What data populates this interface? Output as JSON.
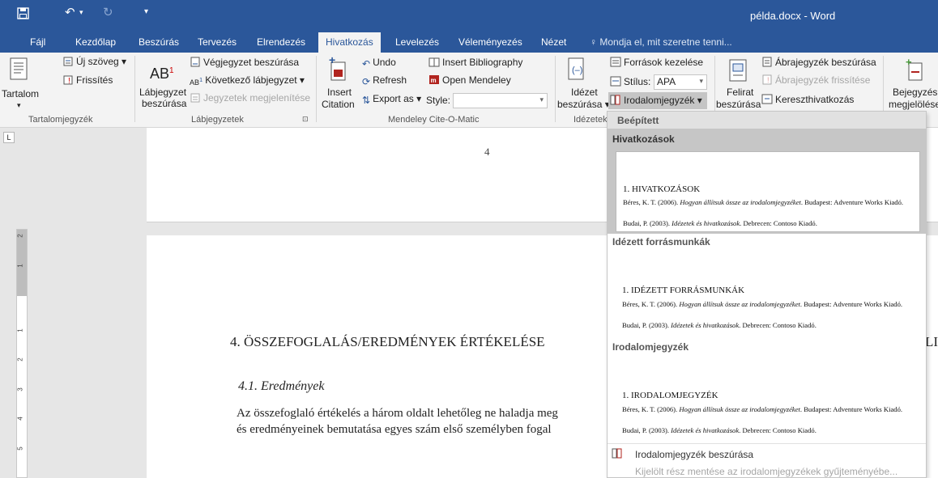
{
  "window": {
    "title": "példa.docx - Word"
  },
  "tabs": [
    "Fájl",
    "Kezdőlap",
    "Beszúrás",
    "Tervezés",
    "Elrendezés",
    "Hivatkozás",
    "Levelezés",
    "Véleményezés",
    "Nézet"
  ],
  "tell_me": "Mondja el, mit szeretne tenni...",
  "ribbon": {
    "toc": {
      "label1": "Tartalom",
      "add_text": "Új szöveg",
      "update": "Frissítés",
      "group": "Tartalomjegyzék"
    },
    "footnotes": {
      "insert_line1": "Lábjegyzet",
      "insert_line2": "beszúrása",
      "endnote": "Végjegyzet beszúrása",
      "next": "Következő lábjegyzet",
      "show": "Jegyzetek megjelenítése",
      "group": "Lábjegyzetek"
    },
    "mendeley": {
      "insert_line1": "Insert",
      "insert_line2": "Citation",
      "undo": "Undo",
      "refresh": "Refresh",
      "export": "Export as",
      "bibliography": "Insert Bibliography",
      "open": "Open Mendeley",
      "style_label": "Style:",
      "style_value": "",
      "group": "Mendeley Cite-O-Matic"
    },
    "citations": {
      "insert_line1": "Idézet",
      "insert_line2": "beszúrása",
      "manage": "Források kezelése",
      "style_label": "Stílus:",
      "style_value": "APA",
      "bibliography": "Irodalomjegyzék",
      "group": "Idézetek"
    },
    "captions": {
      "insert_line1": "Felirat",
      "insert_line2": "beszúrása",
      "table_of_figures": "Ábrajegyzék beszúrása",
      "update_table": "Ábrajegyzék frissítése",
      "cross_ref": "Kereszthivatkozás"
    },
    "index": {
      "mark_line1": "Bejegyzés",
      "mark_line2": "megjelölése"
    }
  },
  "document": {
    "page_number": "4",
    "heading": "4. ÖSSZEFOGLALÁS/EREDMÉNYEK ÉRTÉKELÉSE",
    "heading_overflow": "LI",
    "subheading": "4.1. Eredmények",
    "para_line1": "Az összefoglaló értékelés a három oldalt lehetőleg ne haladja meg",
    "para_line2": "és eredményeinek bemutatása egyes szám első személyben fogal",
    "tabstop": "L",
    "ruler_numbers": [
      "2",
      "1",
      "1",
      "2",
      "3",
      "4",
      "5"
    ]
  },
  "dropdown": {
    "header": "Beépített",
    "items": [
      {
        "label": "Hivatkozások",
        "heading": "1. HIVATKOZÁSOK",
        "ref1_author": "Béres, K. T. (2006). ",
        "ref1_title": "Hogyan állítsuk össze az irodalomjegyzéket",
        "ref1_rest": ". Budapest: Adventure Works Kiadó.",
        "ref2_author": "Budai, P. (2003). ",
        "ref2_title": "Idézetek és hivatkozások",
        "ref2_rest": ". Debrecen: Contoso Kiadó."
      },
      {
        "label": "Idézett forrásmunkák",
        "heading": "1. IDÉZETT FORRÁSMUNKÁK",
        "ref1_author": "Béres, K. T. (2006). ",
        "ref1_title": "Hogyan állítsuk össze az irodalomjegyzéket",
        "ref1_rest": ". Budapest: Adventure Works Kiadó.",
        "ref2_author": "Budai, P. (2003). ",
        "ref2_title": "Idézetek és hivatkozások",
        "ref2_rest": ". Debrecen: Contoso Kiadó."
      },
      {
        "label": "Irodalomjegyzék",
        "heading": "1. IRODALOMJEGYZÉK",
        "ref1_author": "Béres, K. T. (2006). ",
        "ref1_title": "Hogyan állítsuk össze az irodalomjegyzéket",
        "ref1_rest": ". Budapest: Adventure Works Kiadó.",
        "ref2_author": "Budai, P. (2003). ",
        "ref2_title": "Idézetek és hivatkozások",
        "ref2_rest": ". Debrecen: Contoso Kiadó."
      }
    ],
    "insert_bibliography": "Irodalomjegyzék beszúrása",
    "save_selection": "Kijelölt rész mentése az irodalomjegyzékek gyűjteményébe..."
  },
  "colors": {
    "accent": "#2b579a",
    "mendeley_red": "#b1241f"
  }
}
